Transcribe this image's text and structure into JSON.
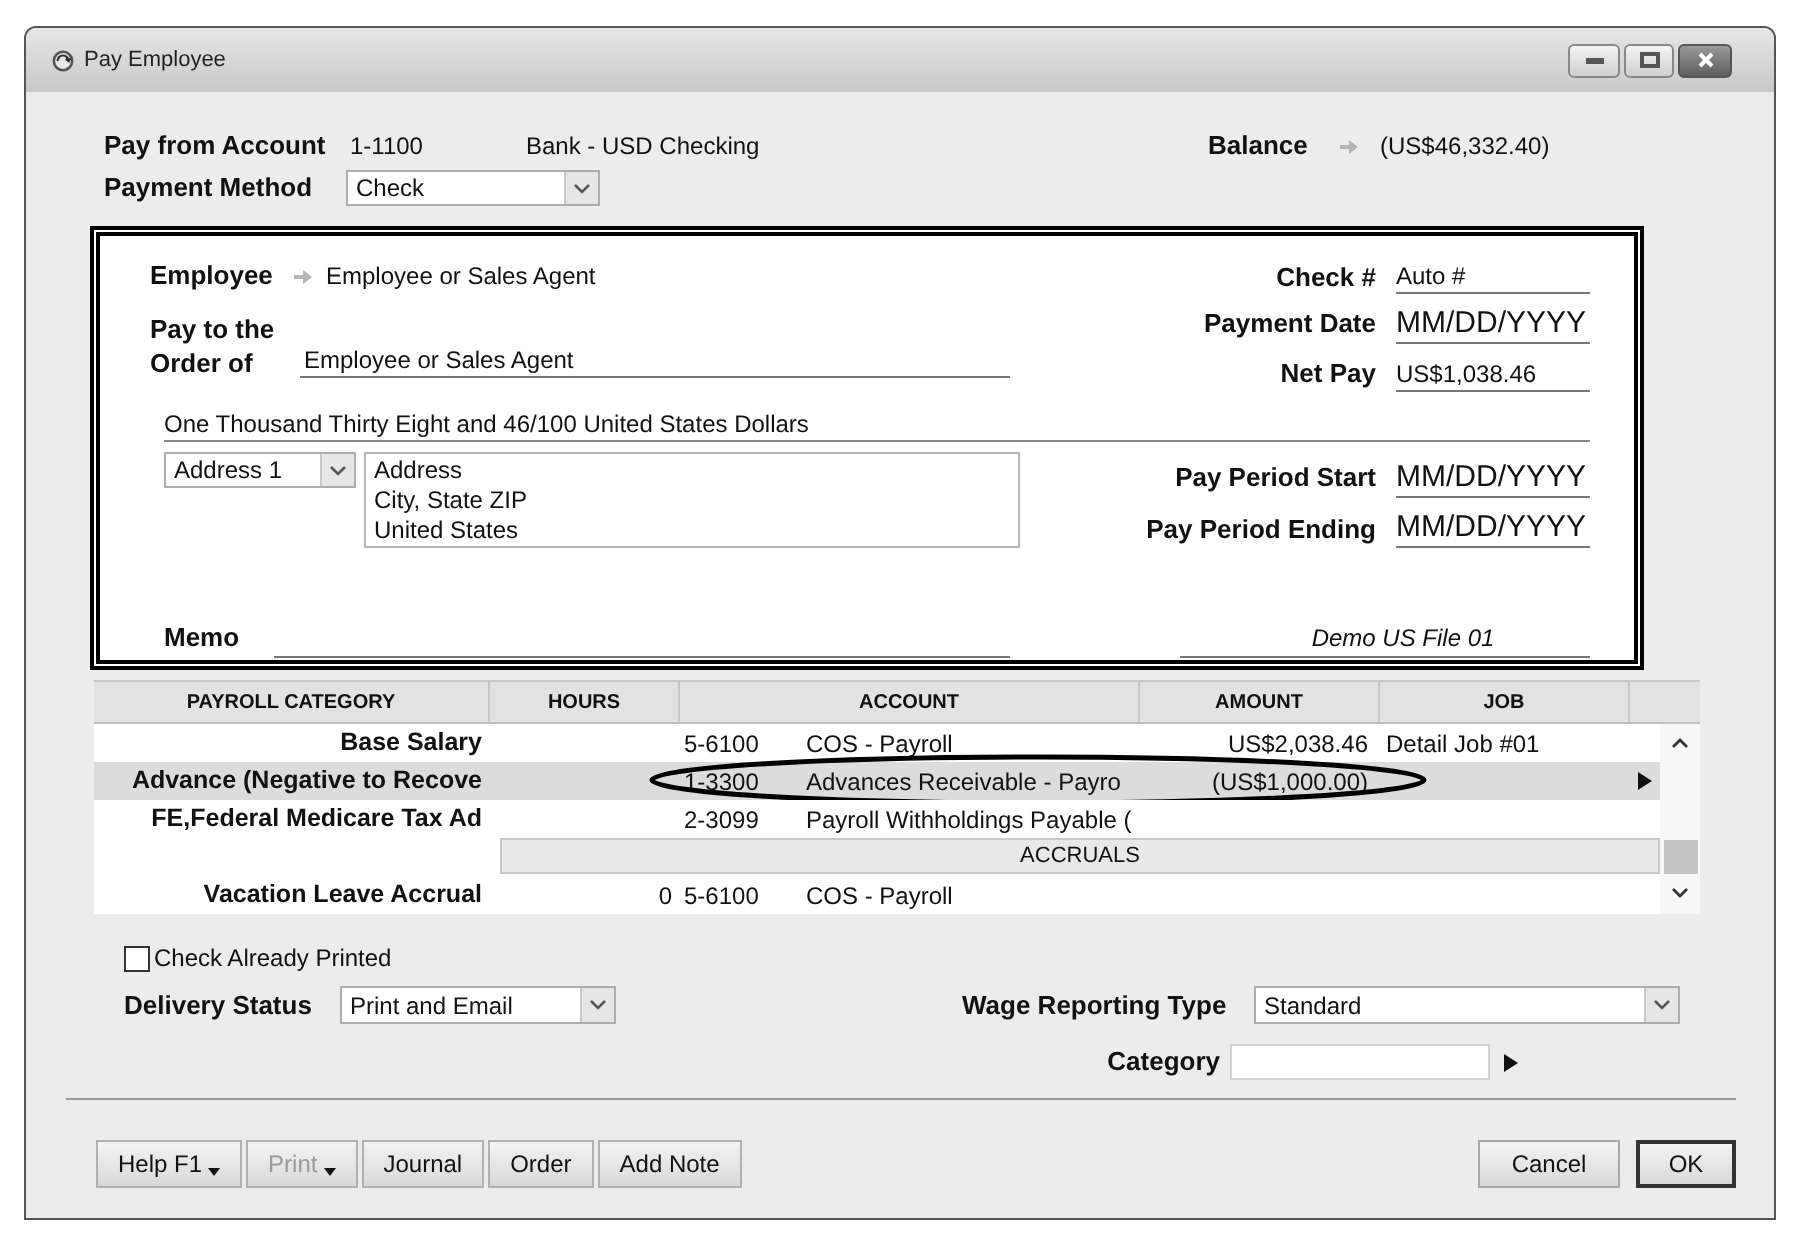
{
  "window": {
    "title": "Pay Employee"
  },
  "account": {
    "label": "Pay from Account",
    "number": "1-1100",
    "name": "Bank - USD Checking"
  },
  "balance": {
    "label": "Balance",
    "value": "(US$46,332.40)"
  },
  "payment_method": {
    "label": "Payment Method",
    "value": "Check"
  },
  "check": {
    "employee": {
      "label": "Employee",
      "value": "Employee or Sales Agent"
    },
    "pay_to": {
      "label": [
        "Pay to the",
        "Order of"
      ],
      "value": "Employee or Sales Agent"
    },
    "fields": [
      {
        "label": "Check #",
        "value": "Auto #",
        "kind": "text"
      },
      {
        "label": "Payment Date",
        "value": "MM/DD/YYYY",
        "kind": "date"
      },
      {
        "label": "Net Pay",
        "value": "US$1,038.46",
        "kind": "text"
      }
    ],
    "amount_in_words": "One Thousand Thirty Eight and 46/100 United States Dollars",
    "address": {
      "selector": "Address 1",
      "lines": [
        "Address",
        "City, State ZIP",
        "United States"
      ]
    },
    "period": [
      {
        "label": "Pay Period Start",
        "value": "MM/DD/YYYY"
      },
      {
        "label": "Pay Period Ending",
        "value": "MM/DD/YYYY"
      }
    ],
    "memo": {
      "label": "Memo"
    },
    "file_name": "Demo US File 01"
  },
  "table": {
    "columns": [
      "PAYROLL CATEGORY",
      "HOURS",
      "ACCOUNT",
      "AMOUNT",
      "JOB"
    ],
    "rows": [
      {
        "kind": "line",
        "selected": false,
        "circled": false,
        "category": "Base Salary",
        "account_number": "5-6100",
        "account_name": "COS - Payroll",
        "amount": "US$2,038.46",
        "job": "Detail Job #01"
      },
      {
        "kind": "line",
        "selected": true,
        "circled": true,
        "category": "Advance (Negative to Recove",
        "account_number": "1-3300",
        "account_name": "Advances Receivable - Payro",
        "amount": "(US$1,000.00)"
      },
      {
        "kind": "line",
        "selected": false,
        "circled": false,
        "category": "FE,Federal Medicare Tax Ad",
        "account_number": "2-3099",
        "account_name": "Payroll Withholdings Payable ("
      },
      {
        "kind": "section",
        "selected": false,
        "circled": false,
        "label": "ACCRUALS"
      },
      {
        "kind": "line",
        "selected": false,
        "circled": false,
        "category": "Vacation Leave Accrual",
        "hours": "0",
        "account_number": "5-6100",
        "account_name": "COS - Payroll"
      }
    ]
  },
  "check_already_printed": {
    "label": "Check Already Printed",
    "checked": false
  },
  "delivery_status": {
    "label": "Delivery Status",
    "value": "Print and Email"
  },
  "wage_reporting_type": {
    "label": "Wage Reporting Type",
    "value": "Standard"
  },
  "category": {
    "label": "Category"
  },
  "buttons": [
    {
      "label": "Help F1",
      "kind": "menu",
      "disabled": false
    },
    {
      "label": "Print",
      "kind": "menu",
      "disabled": true
    },
    {
      "label": "Journal",
      "kind": "plain",
      "disabled": false
    },
    {
      "label": "Order",
      "kind": "plain",
      "disabled": false
    },
    {
      "label": "Add Note",
      "kind": "plain",
      "disabled": false
    }
  ],
  "dialog_buttons": [
    {
      "label": "Cancel",
      "default": false
    },
    {
      "label": "OK",
      "default": true
    }
  ]
}
